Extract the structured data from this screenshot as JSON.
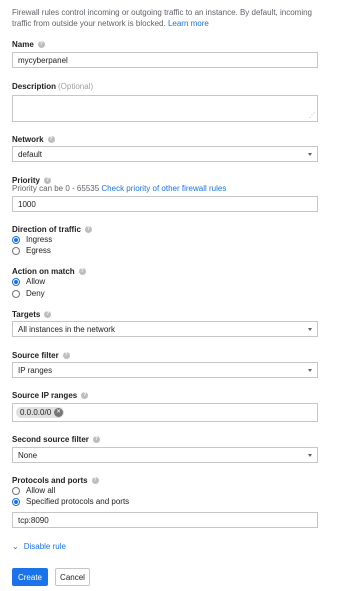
{
  "intro": {
    "text": "Firewall rules control incoming or outgoing traffic to an instance. By default, incoming traffic from outside your network is blocked.",
    "link": "Learn more"
  },
  "name": {
    "label": "Name",
    "value": "mycyberpanel"
  },
  "description": {
    "label": "Description",
    "optional": "(Optional)",
    "value": ""
  },
  "network": {
    "label": "Network",
    "value": "default"
  },
  "priority": {
    "label": "Priority",
    "hint": "Priority can be 0 - 65535",
    "hint_link": "Check priority of other firewall rules",
    "value": "1000"
  },
  "direction": {
    "label": "Direction of traffic",
    "options": [
      "Ingress",
      "Egress"
    ],
    "selected": "Ingress"
  },
  "action": {
    "label": "Action on match",
    "options": [
      "Allow",
      "Deny"
    ],
    "selected": "Allow"
  },
  "targets": {
    "label": "Targets",
    "value": "All instances in the network"
  },
  "source_filter": {
    "label": "Source filter",
    "value": "IP ranges"
  },
  "source_ip_ranges": {
    "label": "Source IP ranges",
    "chips": [
      "0.0.0.0/0"
    ]
  },
  "second_source_filter": {
    "label": "Second source filter",
    "value": "None"
  },
  "protocols": {
    "label": "Protocols and ports",
    "options": [
      "Allow all",
      "Specified protocols and ports"
    ],
    "selected": "Specified protocols and ports",
    "value": "tcp:8090"
  },
  "disable_rule": "Disable rule",
  "buttons": {
    "create": "Create",
    "cancel": "Cancel"
  },
  "colors": {
    "accent": "#1a73e8",
    "border": "#c6c6c6",
    "text": "#212121",
    "muted": "#5f6368"
  }
}
